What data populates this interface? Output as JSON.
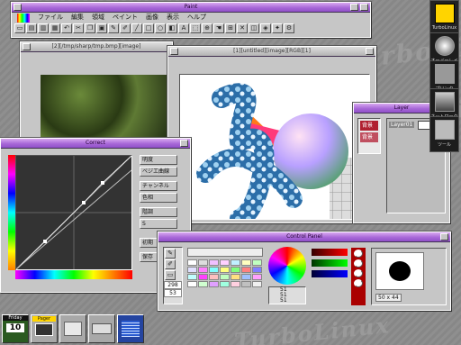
{
  "palette": {
    "accent": "#a868d8",
    "title_active": "#b070e0",
    "desktop": "#8a8a8a"
  },
  "desktop": {
    "watermark": "TurboLinux"
  },
  "paint_window": {
    "title": "Paint",
    "menu": [
      "ファイル",
      "編集",
      "領域",
      "ペイント",
      "画像",
      "表示",
      "ヘルプ"
    ],
    "tools": [
      "new-icon",
      "open-icon",
      "save-icon",
      "print-icon",
      "undo-icon",
      "cut-icon",
      "copy-icon",
      "paste-icon",
      "pencil-icon",
      "brush-icon",
      "line-icon",
      "rect-icon",
      "ellipse-icon",
      "fill-icon",
      "text-icon",
      "select-icon",
      "zoom-icon",
      "hand-icon",
      "grid-icon",
      "close-icon",
      "layer-icon",
      "filter-icon",
      "effect-icon",
      "settings-icon"
    ]
  },
  "photo_window": {
    "title": "[2][/tmp/sharp/tmp.bmp][image]"
  },
  "canvas_window": {
    "title": "[1][untitled][image][RGB][1]"
  },
  "layer_window": {
    "title": "Layer",
    "rows": [
      {
        "name": "背景"
      },
      {
        "name": "背景"
      }
    ],
    "top_label": "Layer01"
  },
  "correct_window": {
    "title": "Correct",
    "buttons": [
      "明度",
      "ベジエ曲線",
      "チャンネル",
      "色相",
      "階調",
      "S"
    ],
    "lower_buttons": [
      "初期",
      "保存"
    ]
  },
  "control_panel": {
    "title": "Control Panel",
    "values": [
      "298",
      "53"
    ],
    "rgb": [
      "51",
      "51",
      "51"
    ],
    "size": "50 x 44"
  },
  "side_icons": [
    {
      "label": "TurboLinux"
    },
    {
      "label": "オーバーレイ"
    },
    {
      "label": "プリンタ"
    },
    {
      "label": "ネットワーク"
    },
    {
      "label": "ツール"
    }
  ],
  "taskbar": {
    "clock_day": "10",
    "clock_label": "Friday",
    "pager_label": "Pager"
  }
}
